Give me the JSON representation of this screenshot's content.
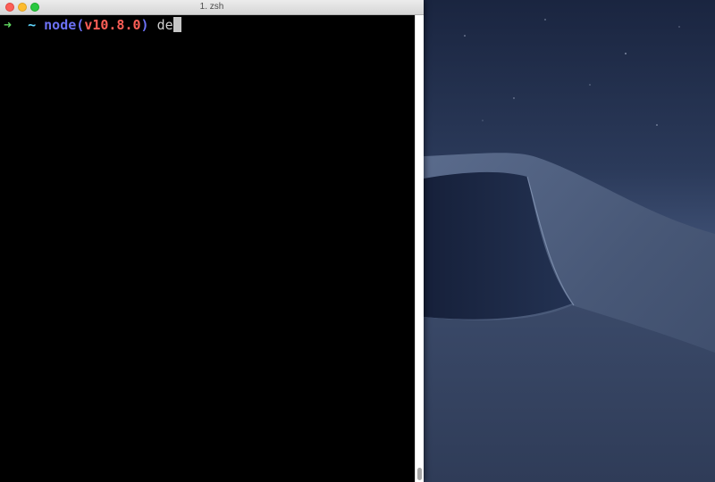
{
  "window": {
    "title": "1. zsh"
  },
  "terminal": {
    "prompt_arrow": "➜",
    "cwd": "~",
    "node_label": "node",
    "node_version_open": "(",
    "node_version": "v10.8.0",
    "node_version_close": ")",
    "typed_input": "de"
  },
  "icons": {
    "close": "close-dot",
    "minimize": "minimize-dot",
    "zoom": "zoom-dot"
  },
  "colors": {
    "close": "#fc5f57",
    "minimize": "#fdbc2e",
    "zoom": "#2ac840",
    "prompt_arrow": "#5fd75f",
    "cwd": "#5fd7ff",
    "node_label": "#6c71f4",
    "node_version": "#ff5f57",
    "terminal_bg": "#000000",
    "wallpaper_sky": "#1d2a44"
  }
}
